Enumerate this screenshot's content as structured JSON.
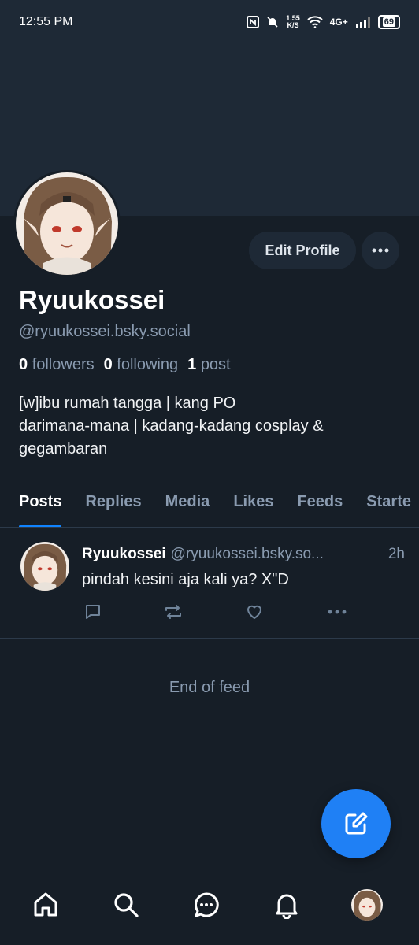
{
  "status_bar": {
    "time": "12:55 PM",
    "speed_value": "1.55",
    "speed_unit": "K/S",
    "network": "4G+",
    "battery": "69"
  },
  "profile": {
    "display_name": "Ryuukossei",
    "handle": "@ryuukossei.bsky.social",
    "edit_label": "Edit Profile",
    "followers_count": "0",
    "followers_label": "followers",
    "following_count": "0",
    "following_label": "following",
    "posts_count": "1",
    "posts_label": "post",
    "bio_lines": [
      "[w]ibu rumah tangga | kang PO",
      "darimana-mana | kadang-kadang cosplay &",
      "gegambaran"
    ]
  },
  "tabs": [
    {
      "label": "Posts"
    },
    {
      "label": "Replies"
    },
    {
      "label": "Media"
    },
    {
      "label": "Likes"
    },
    {
      "label": "Feeds"
    },
    {
      "label": "Starte"
    }
  ],
  "post": {
    "author": "Ryuukossei",
    "handle": "@ryuukossei.bsky.so...",
    "time": "2h",
    "text": "pindah kesini aja kali ya? X\"D"
  },
  "feed": {
    "end_label": "End of feed"
  },
  "colors": {
    "accent": "#1083fe",
    "background": "#161e27",
    "banner": "#1e2936",
    "muted_text": "#8a9bb0"
  },
  "icons": {
    "bottom_nav": [
      "home-icon",
      "search-icon",
      "chat-icon",
      "bell-icon",
      "profile-avatar"
    ],
    "post_actions": [
      "reply-icon",
      "repost-icon",
      "like-icon",
      "more-icon"
    ],
    "fab": "compose-icon"
  }
}
